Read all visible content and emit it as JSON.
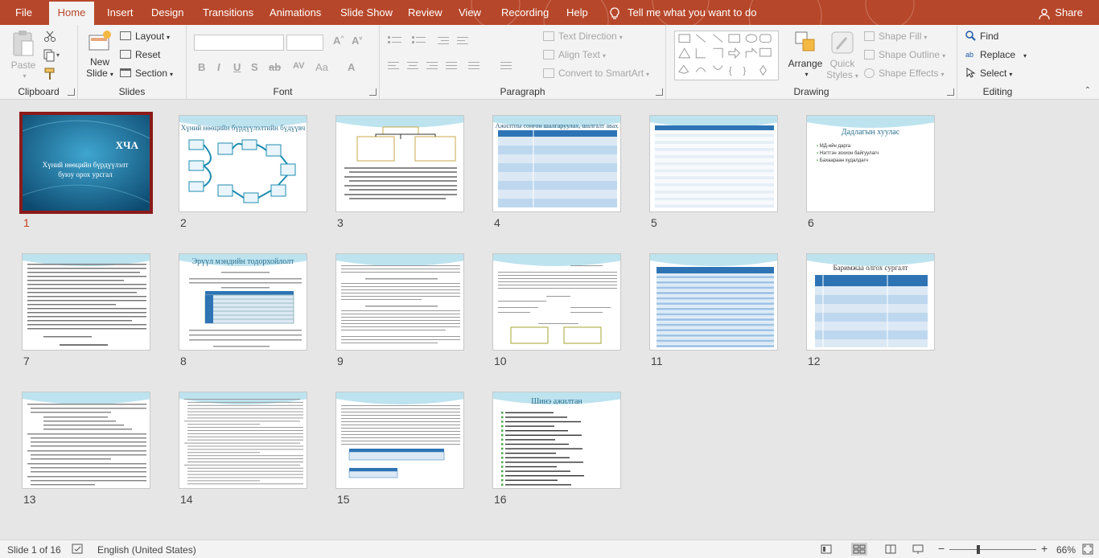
{
  "ribbon_tabs": [
    "File",
    "Home",
    "Insert",
    "Design",
    "Transitions",
    "Animations",
    "Slide Show",
    "Review",
    "View",
    "Recording",
    "Help"
  ],
  "active_tab": "Home",
  "tell_me": "Tell me what you want to do",
  "share": "Share",
  "clipboard": {
    "label": "Clipboard",
    "paste": "Paste"
  },
  "slides_group": {
    "label": "Slides",
    "new_slide_line1": "New",
    "new_slide_line2": "Slide",
    "layout": "Layout",
    "reset": "Reset",
    "section": "Section"
  },
  "font_group": {
    "label": "Font"
  },
  "paragraph_group": {
    "label": "Paragraph",
    "text_direction": "Text Direction",
    "align_text": "Align Text",
    "convert_smartart": "Convert to SmartArt"
  },
  "drawing_group": {
    "label": "Drawing",
    "arrange": "Arrange",
    "quick_styles_1": "Quick",
    "quick_styles_2": "Styles",
    "shape_fill": "Shape Fill",
    "shape_outline": "Shape Outline",
    "shape_effects": "Shape Effects"
  },
  "editing_group": {
    "label": "Editing",
    "find": "Find",
    "replace": "Replace",
    "select": "Select"
  },
  "slides": [
    {
      "n": "1",
      "title": "ХЧА",
      "subtitle": "Хүний нөөцийн бүрдүүлэлт буюу орох урсгал",
      "selected": true
    },
    {
      "n": "2",
      "title": "Хүний нөөцийн бүрдүүлэлтийн бүдүүвч"
    },
    {
      "n": "3",
      "title": ""
    },
    {
      "n": "4",
      "title": "Ажилтны сонгон шалгаруулах, шалгалт авах"
    },
    {
      "n": "5",
      "title": ""
    },
    {
      "n": "6",
      "title": "Дадлагын хуулас",
      "bullets": [
        "МД-ийн дарга",
        "Нэгтгэн зохион байгуулагч",
        "Бахаараан худалдагч"
      ]
    },
    {
      "n": "7",
      "title": ""
    },
    {
      "n": "8",
      "title": "Эрүүл мэндийн тодорхойлолт"
    },
    {
      "n": "9",
      "title": ""
    },
    {
      "n": "10",
      "title": ""
    },
    {
      "n": "11",
      "title": ""
    },
    {
      "n": "12",
      "title": "Баримжаа олгох сургалт"
    },
    {
      "n": "13",
      "title": ""
    },
    {
      "n": "14",
      "title": ""
    },
    {
      "n": "15",
      "title": ""
    },
    {
      "n": "16",
      "title": "Шинэ ажилтан"
    }
  ],
  "status": {
    "slide": "Slide 1 of 16",
    "language": "English (United States)",
    "zoom": "66%"
  },
  "colors": {
    "accent": "#b7472a",
    "selected_outline": "#8b1a1a",
    "slide_teal": "#1c6f98"
  }
}
